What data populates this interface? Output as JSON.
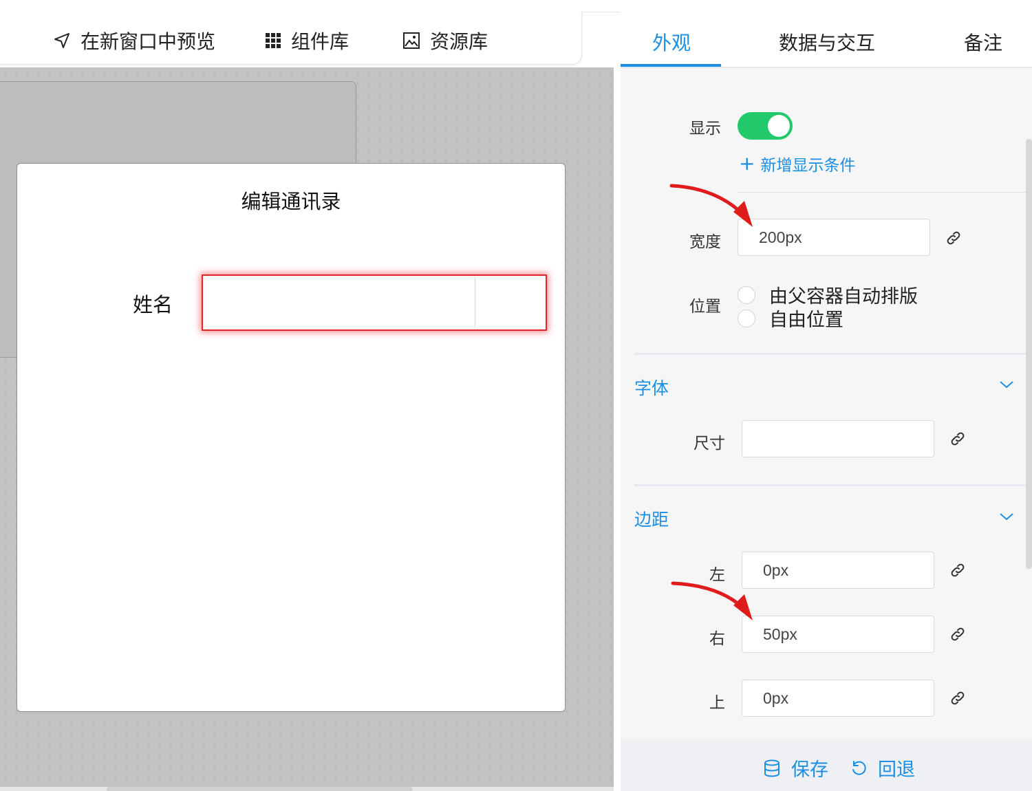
{
  "toolbar": {
    "preview_label": "在新窗口中预览",
    "components_label": "组件库",
    "assets_label": "资源库"
  },
  "canvas": {
    "dialog_title": "编辑通讯录",
    "name_label": "姓名",
    "name_value": ""
  },
  "panel": {
    "tabs": [
      {
        "label": "外观"
      },
      {
        "label": "数据与交互"
      },
      {
        "label": "备注"
      }
    ],
    "display_label": "显示",
    "display_on": true,
    "add_condition": "新增显示条件",
    "width_label": "宽度",
    "width_value": "200px",
    "position_label": "位置",
    "position_options": [
      "由父容器自动排版",
      "自由位置"
    ],
    "font_section": "字体",
    "size_label": "尺寸",
    "size_value": "",
    "margin_section": "边距",
    "margin_left_label": "左",
    "margin_left_value": "0px",
    "margin_right_label": "右",
    "margin_right_value": "50px",
    "margin_top_label": "上",
    "margin_top_value": "0px",
    "save_label": "保存",
    "revert_label": "回退"
  },
  "colors": {
    "accent": "#1a8fe3",
    "toggle_on": "#22c96a",
    "highlight": "#e5222b",
    "annotation_arrow": "#e01b1b"
  }
}
